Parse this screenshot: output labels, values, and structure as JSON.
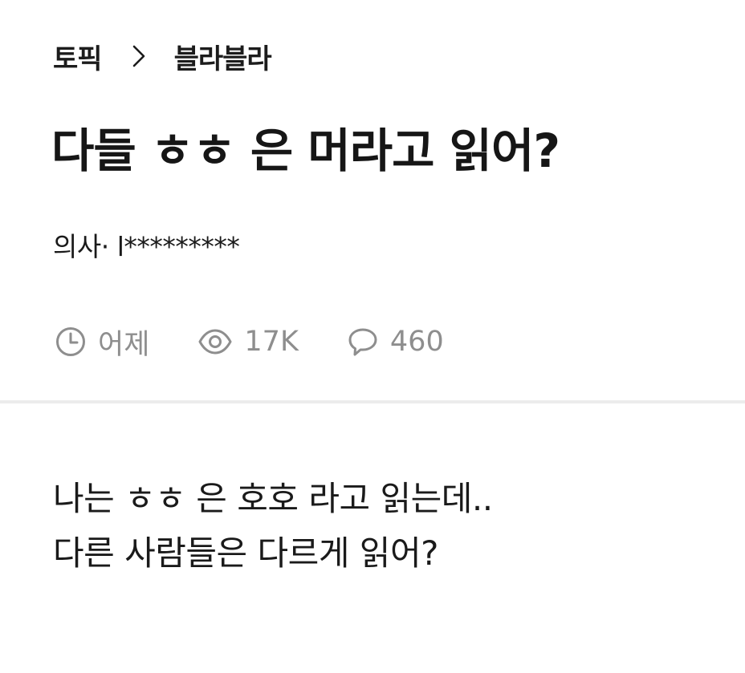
{
  "breadcrumb": {
    "topic": "토픽",
    "separator_icon": "chevron-right-icon",
    "board": "블라블라"
  },
  "post": {
    "title": "다들 ㅎㅎ 은 머라고 읽어?",
    "author": "의사· l*********",
    "meta": {
      "time": "어제",
      "views": "17K",
      "comments": "460"
    },
    "body": [
      "나는 ㅎㅎ 은 호호 라고 읽는데..",
      "다른 사람들은 다르게 읽어?"
    ]
  },
  "icons": {
    "time": "clock-icon",
    "views": "eye-icon",
    "comments": "speech-bubble-icon"
  },
  "colors": {
    "text": "#1a1a1a",
    "meta": "#8e8e8e",
    "divider": "#ececec",
    "background": "#ffffff"
  }
}
